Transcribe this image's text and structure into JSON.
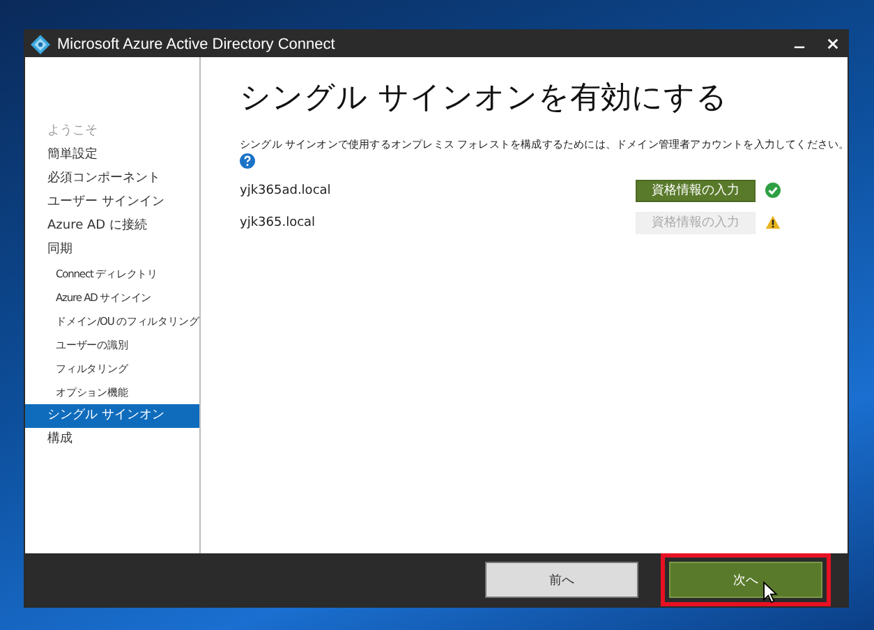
{
  "window": {
    "title": "Microsoft Azure Active Directory Connect"
  },
  "sidebar": {
    "items": [
      {
        "label": "ようこそ",
        "disabled": true,
        "selected": false
      },
      {
        "label": "簡単設定",
        "disabled": false,
        "selected": false
      },
      {
        "label": "必須コンポーネント",
        "disabled": false,
        "selected": false
      },
      {
        "label": "ユーザー サインイン",
        "disabled": false,
        "selected": false
      },
      {
        "label": "Azure AD に接続",
        "disabled": false,
        "selected": false
      },
      {
        "label": "同期",
        "disabled": false,
        "selected": false,
        "children": [
          {
            "label": "Connect ディレクトリ",
            "disabled": false,
            "selected": false
          },
          {
            "label": "Azure AD サインイン",
            "disabled": false,
            "selected": false
          },
          {
            "label": "ドメイン/OU のフィルタリング",
            "disabled": false,
            "selected": false
          },
          {
            "label": "ユーザーの識別",
            "disabled": false,
            "selected": false
          },
          {
            "label": "フィルタリング",
            "disabled": false,
            "selected": false
          },
          {
            "label": "オプション機能",
            "disabled": false,
            "selected": false
          }
        ]
      },
      {
        "label": "シングル サインオン",
        "disabled": false,
        "selected": true
      },
      {
        "label": "構成",
        "disabled": false,
        "selected": false
      }
    ]
  },
  "page": {
    "heading": "シングル サインオンを有効にする",
    "description": "シングル サインオンで使用するオンプレミス フォレストを構成するためには、ドメイン管理者アカウントを入力してください。",
    "forests": [
      {
        "domain": "yjk365ad.local",
        "button": "資格情報の入力",
        "disabled": false,
        "verified": true
      },
      {
        "domain": "yjk365.local",
        "button": "資格情報の入力",
        "disabled": true,
        "verified": false
      }
    ]
  },
  "footer": {
    "buttons": [
      {
        "label": "前へ",
        "kind": "secondary",
        "highlighted": false
      },
      {
        "label": "次へ",
        "kind": "primary",
        "highlighted": true
      }
    ]
  }
}
